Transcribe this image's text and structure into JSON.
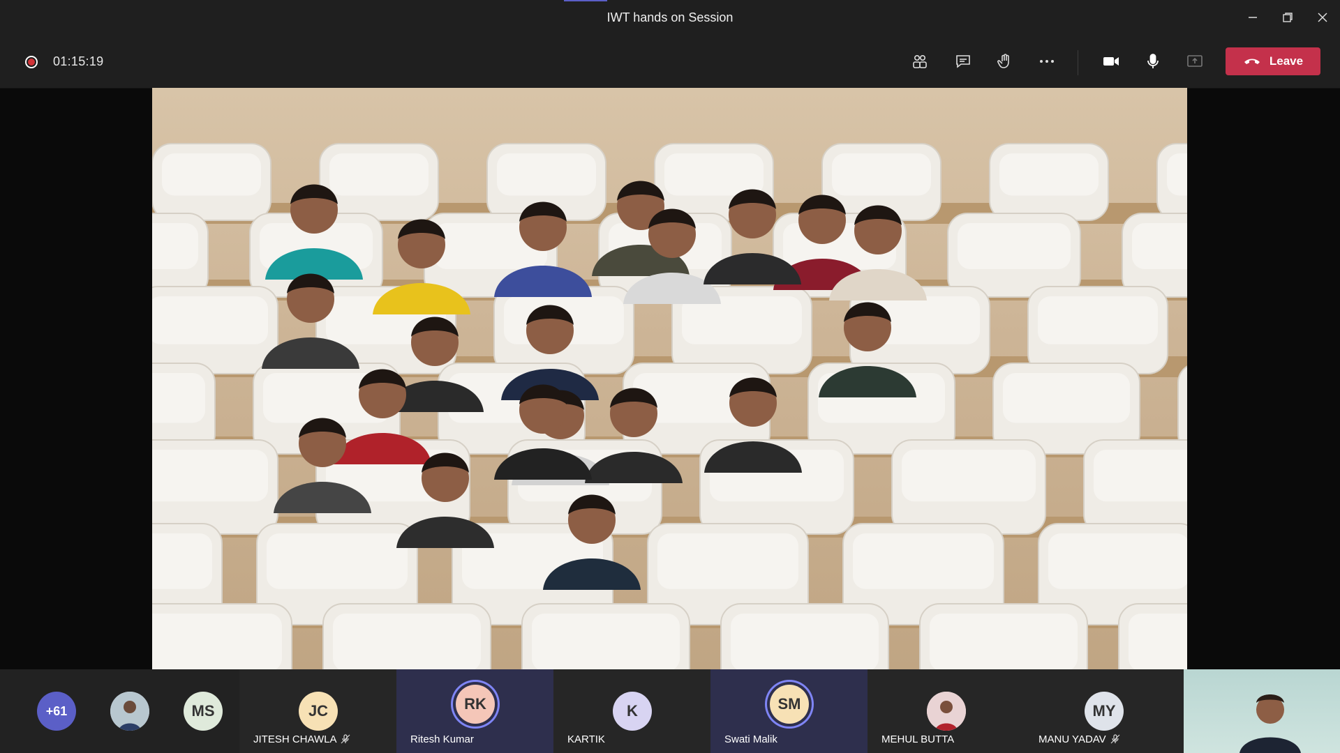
{
  "window": {
    "title": "IWT hands on Session"
  },
  "toolbar": {
    "recording_timer": "01:15:19",
    "leave_label": "Leave",
    "icons": [
      "participants-icon",
      "chat-icon",
      "raise-hand-icon",
      "more-options-icon",
      "camera-icon",
      "microphone-icon",
      "share-screen-icon"
    ]
  },
  "strip": {
    "overflow_count": "+61",
    "ms_initials": "MS",
    "participants": [
      {
        "initials": "JC",
        "name": "JITESH CHAWLA",
        "muted": true,
        "color": "#f7e1b5"
      },
      {
        "initials": "RK",
        "name": "Ritesh Kumar",
        "muted": false,
        "speaking": true,
        "color": "#f4c6b8"
      },
      {
        "initials": "K",
        "name": "KARTIK",
        "muted": false,
        "color": "#d8d4f2"
      },
      {
        "initials": "SM",
        "name": "Swati Malik",
        "muted": false,
        "speaking": true,
        "color": "#f7e1b5"
      },
      {
        "initials": "",
        "name": "MEHUL BUTTA",
        "muted": false,
        "photo": true
      },
      {
        "initials": "MY",
        "name": "MANU YADAV",
        "muted": true,
        "color": "#dfe3ea"
      }
    ]
  },
  "colors": {
    "leave": "#c4314b",
    "speaking_ring": "#7f85f5",
    "overflow": "#5b5fc7"
  }
}
